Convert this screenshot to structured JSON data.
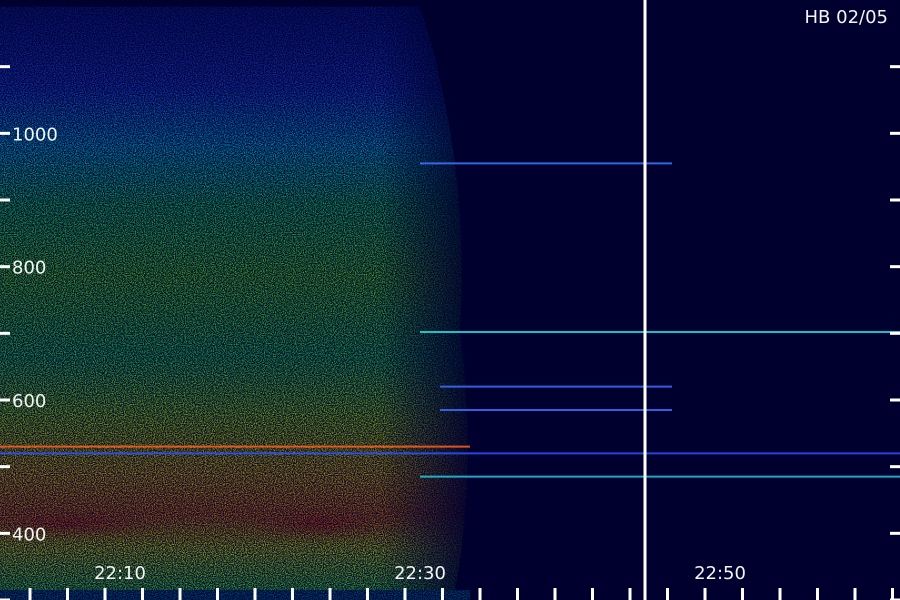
{
  "chart_data": {
    "type": "heatmap",
    "corner_label": "HB 02/05",
    "y_ticks": [
      {
        "value": 1000,
        "label": "1000"
      },
      {
        "value": 800,
        "label": "800"
      },
      {
        "value": 600,
        "label": "600"
      },
      {
        "value": 400,
        "label": "400"
      }
    ],
    "x_ticks": [
      {
        "value": 10,
        "label": "22:10"
      },
      {
        "value": 30,
        "label": "22:30"
      },
      {
        "value": 50,
        "label": "22:50"
      }
    ],
    "xlim": [
      2,
      62
    ],
    "ylim": [
      300,
      1200
    ],
    "marker_line_x": 45,
    "colors": {
      "background": "#00002e",
      "low": "#1e3cff",
      "mid": "#00e0ff",
      "high": "#40ff40",
      "peak": "#ff5a00"
    }
  }
}
